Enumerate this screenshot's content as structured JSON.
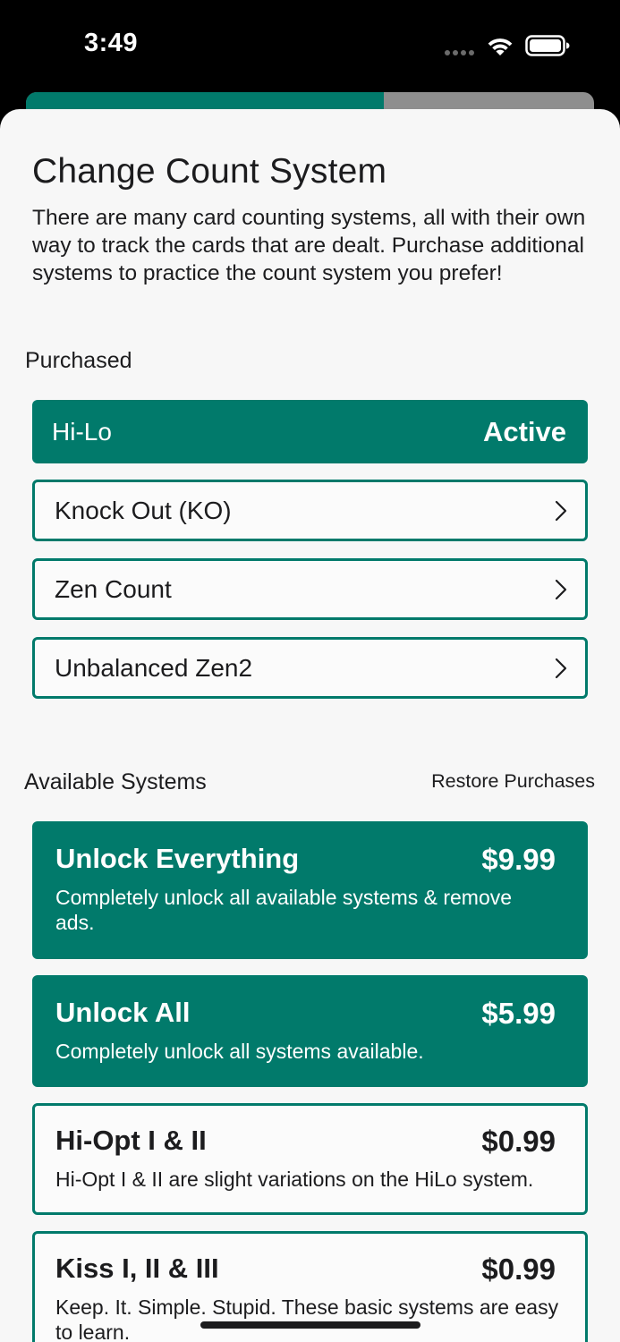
{
  "status_bar": {
    "time": "3:49"
  },
  "progress": {
    "fraction": 0.63,
    "fill_color": "#017a6b",
    "track_color": "#8e8e8e"
  },
  "header": {
    "title": "Change Count System",
    "description": "There are many card counting systems, all with their own way to track the cards that are dealt. Purchase additional systems to practice the count system you prefer!"
  },
  "purchased": {
    "heading": "Purchased",
    "items": [
      {
        "label": "Hi-Lo",
        "status": "Active"
      },
      {
        "label": "Knock Out (KO)"
      },
      {
        "label": "Zen Count"
      },
      {
        "label": "Unbalanced Zen2"
      }
    ]
  },
  "available": {
    "heading": "Available Systems",
    "restore_label": "Restore Purchases",
    "products": [
      {
        "title": "Unlock Everything",
        "price": "$9.99",
        "description": "Completely unlock all available systems & remove ads."
      },
      {
        "title": "Unlock All",
        "price": "$5.99",
        "description": "Completely unlock all systems available."
      },
      {
        "title": "Hi-Opt I & II",
        "price": "$0.99",
        "description": "Hi-Opt I & II are slight variations on the HiLo system."
      },
      {
        "title": "Kiss I, II & III",
        "price": "$0.99",
        "description": "Keep. It. Simple. Stupid. These basic systems are easy to learn."
      }
    ]
  },
  "colors": {
    "accent": "#017a6b",
    "background": "#f7f7f7",
    "text": "#1c1c1e"
  },
  "icons": {
    "wifi": "wifi-icon",
    "battery": "battery-icon",
    "chevron": "chevron-right-icon"
  }
}
